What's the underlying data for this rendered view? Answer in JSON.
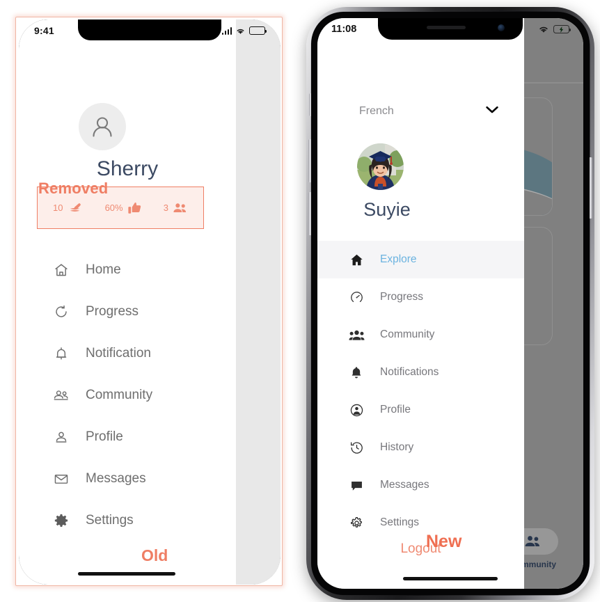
{
  "annotations": {
    "removed": "Removed",
    "old": "Old",
    "new": "New"
  },
  "colors": {
    "accent_salmon": "#ef7e64",
    "accent_salmon_light": "#fdeeea",
    "name_blue": "#3c4a63",
    "active_blue": "#6bb3e0",
    "menu_gray": "#6e6e6e",
    "battery_green": "#4cd964"
  },
  "old_phone": {
    "status_bar": {
      "time": "9:41",
      "icons": [
        "cellular-bars-icon",
        "wifi-icon",
        "battery-icon"
      ]
    },
    "profile": {
      "avatar_icon": "person-avatar-icon",
      "name": "Sherry"
    },
    "stats": [
      {
        "value": "10",
        "icon": "stack-layers-icon"
      },
      {
        "value": "60%",
        "icon": "thumbs-up-icon"
      },
      {
        "value": "3",
        "icon": "people-group-icon"
      }
    ],
    "menu": [
      {
        "label": "Home",
        "icon": "home-icon"
      },
      {
        "label": "Progress",
        "icon": "progress-refresh-icon"
      },
      {
        "label": "Notification",
        "icon": "bell-icon"
      },
      {
        "label": "Community",
        "icon": "people-group-icon"
      },
      {
        "label": "Profile",
        "icon": "person-icon"
      },
      {
        "label": "Messages",
        "icon": "envelope-icon"
      },
      {
        "label": "Settings",
        "icon": "gear-icon"
      }
    ]
  },
  "new_phone": {
    "status_bar": {
      "time": "11:08",
      "icons": [
        "wifi-icon",
        "battery-charging-icon"
      ]
    },
    "language_selector": {
      "value": "French",
      "icon": "chevron-down-icon"
    },
    "profile": {
      "avatar_icon": "graduation-photo-avatar",
      "name": "Suyie"
    },
    "menu": [
      {
        "label": "Explore",
        "icon": "home-icon",
        "active": true
      },
      {
        "label": "Progress",
        "icon": "speedometer-icon",
        "active": false
      },
      {
        "label": "Community",
        "icon": "people-group-icon",
        "active": false
      },
      {
        "label": "Notifications",
        "icon": "bell-icon",
        "active": false
      },
      {
        "label": "Profile",
        "icon": "person-circle-icon",
        "active": false
      },
      {
        "label": "History",
        "icon": "history-clock-icon",
        "active": false
      },
      {
        "label": "Messages",
        "icon": "chat-bubble-icon",
        "active": false
      },
      {
        "label": "Settings",
        "icon": "gear-icon",
        "active": false
      }
    ],
    "logout_label": "Logout",
    "background_app": {
      "tab_label": "Community",
      "tab_icon": "people-group-icon"
    }
  }
}
